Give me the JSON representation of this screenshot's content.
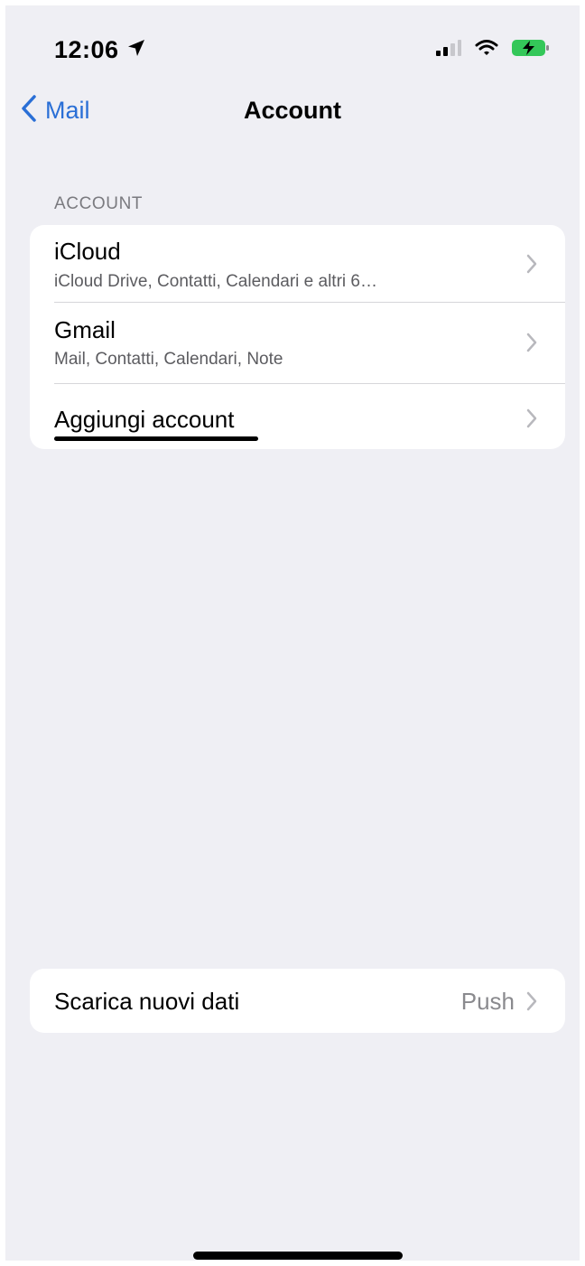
{
  "status_bar": {
    "time": "12:06",
    "icons": [
      "location-arrow-icon",
      "cellular-signal-icon",
      "wifi-icon",
      "battery-charging-icon"
    ],
    "battery_color": "#34c759"
  },
  "nav": {
    "back_label": "Mail",
    "title": "Account"
  },
  "accounts_section": {
    "header": "ACCOUNT",
    "items": [
      {
        "title": "iCloud",
        "subtitle": "iCloud Drive, Contatti, Calendari e altri 6…"
      },
      {
        "title": "Gmail",
        "subtitle": "Mail, Contatti, Calendari, Note"
      },
      {
        "title": "Aggiungi account"
      }
    ]
  },
  "fetch": {
    "label": "Scarica nuovi dati",
    "value": "Push"
  },
  "colors": {
    "accent": "#2a6fd6",
    "background": "#efeff4",
    "card": "#ffffff",
    "secondary_text": "#8a8a8e"
  }
}
